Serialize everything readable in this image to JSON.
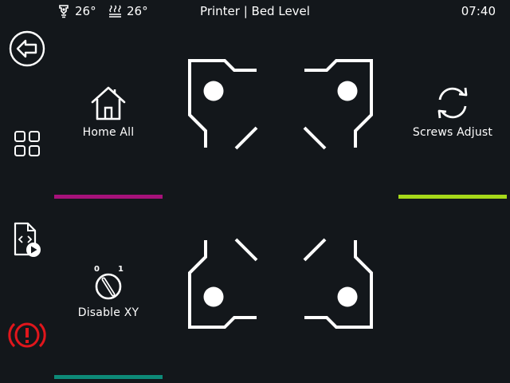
{
  "statusbar": {
    "extruder_temp": "26°",
    "bed_temp": "26°",
    "title": "Printer | Bed Level",
    "time": "07:40"
  },
  "sidebar": {
    "items": [
      {
        "name": "back",
        "icon": "arrow-left-circle-icon"
      },
      {
        "name": "menu",
        "icon": "grid-icon"
      },
      {
        "name": "print",
        "icon": "gcode-file-play-icon"
      },
      {
        "name": "emergency-stop",
        "icon": "emergency-stop-icon",
        "color": "#e0161c"
      }
    ]
  },
  "actions": {
    "home_all": {
      "label": "Home All",
      "icon": "home-icon",
      "color": "#a6117a"
    },
    "screws_adjust": {
      "label": "Screws Adjust",
      "icon": "refresh-icon",
      "color": "#a6d91a"
    },
    "disable_xy": {
      "label": "Disable XY",
      "icon": "motor-switch-icon",
      "color": "#0d8a78",
      "switch_off_label": "0",
      "switch_on_label": "1"
    }
  },
  "bed_corners": [
    {
      "position": "front-left",
      "icon": "bed-corner-icon"
    },
    {
      "position": "front-right",
      "icon": "bed-corner-icon"
    },
    {
      "position": "back-left",
      "icon": "bed-corner-icon"
    },
    {
      "position": "back-right",
      "icon": "bed-corner-icon"
    }
  ],
  "colors": {
    "background": "#13171b",
    "foreground": "#ffffff",
    "emergency": "#e0161c"
  }
}
